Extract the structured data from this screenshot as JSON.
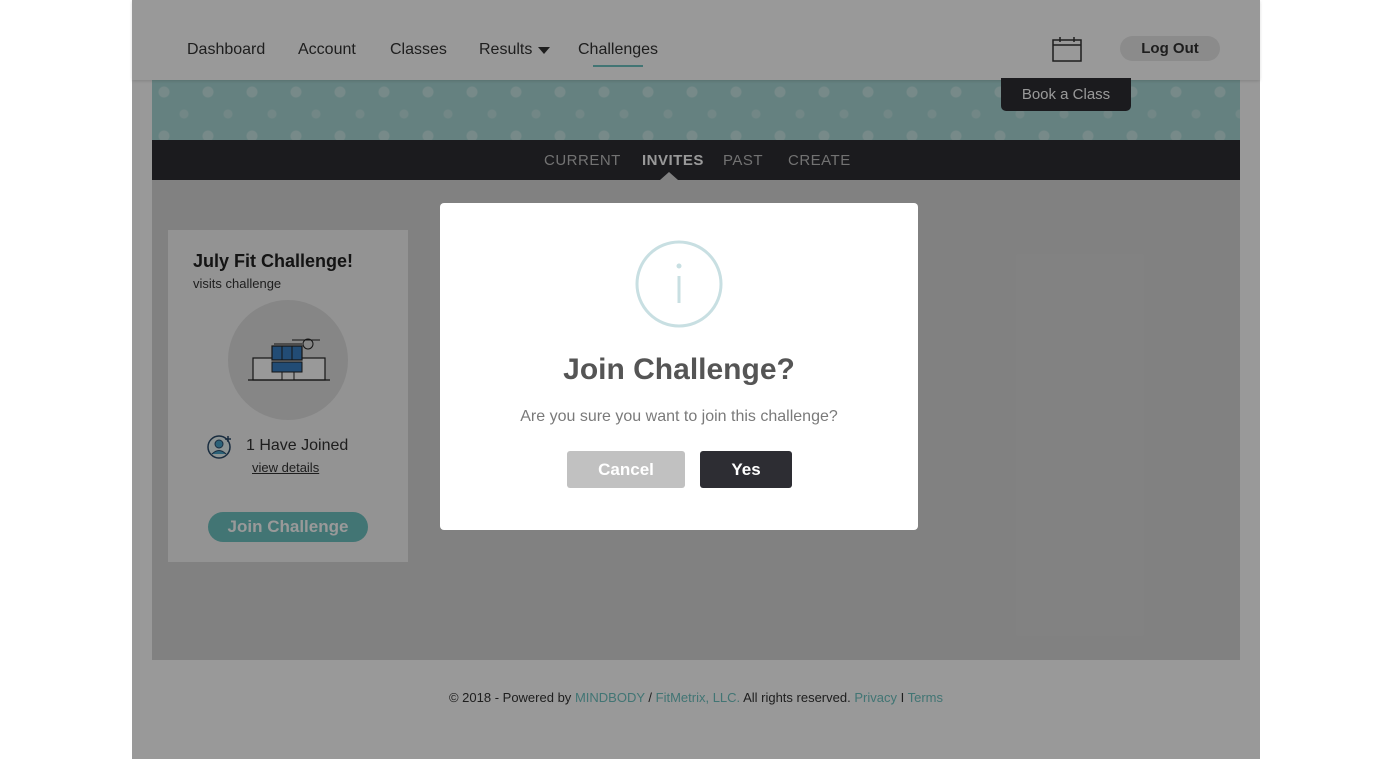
{
  "nav": {
    "items": [
      {
        "label": "Dashboard"
      },
      {
        "label": "Account"
      },
      {
        "label": "Classes"
      },
      {
        "label": "Results"
      },
      {
        "label": "Challenges"
      }
    ],
    "logout_label": "Log Out",
    "calendar_icon": "calendar-icon",
    "results_caret_icon": "chevron-down-icon"
  },
  "banner": {
    "book_label": "Book a Class"
  },
  "subnav": {
    "tabs": [
      {
        "label": "CURRENT"
      },
      {
        "label": "INVITES"
      },
      {
        "label": "PAST"
      },
      {
        "label": "CREATE"
      }
    ],
    "active": "INVITES"
  },
  "card": {
    "title": "July Fit Challenge!",
    "subtitle": "visits challenge",
    "image_icon": "building-illustration",
    "joined_icon": "user-add-icon",
    "joined_text": "1 Have Joined",
    "view_details": "view details",
    "join_label": "Join Challenge"
  },
  "footer": {
    "prefix": "© 2018 - Powered by",
    "mindbody": "MINDBODY",
    "slash": "/",
    "fitmetrix": "FitMetrix, LLC.",
    "rights": "All rights reserved.",
    "privacy": "Privacy",
    "separator": "I",
    "terms": "Terms"
  },
  "modal": {
    "icon": "info-icon",
    "title": "Join Challenge?",
    "text": "Are you sure you want to join this challenge?",
    "cancel_label": "Cancel",
    "yes_label": "Yes"
  },
  "colors": {
    "accent": "#6ec3c1",
    "dark": "#2d2d33",
    "cancel": "#c1c1c1"
  }
}
